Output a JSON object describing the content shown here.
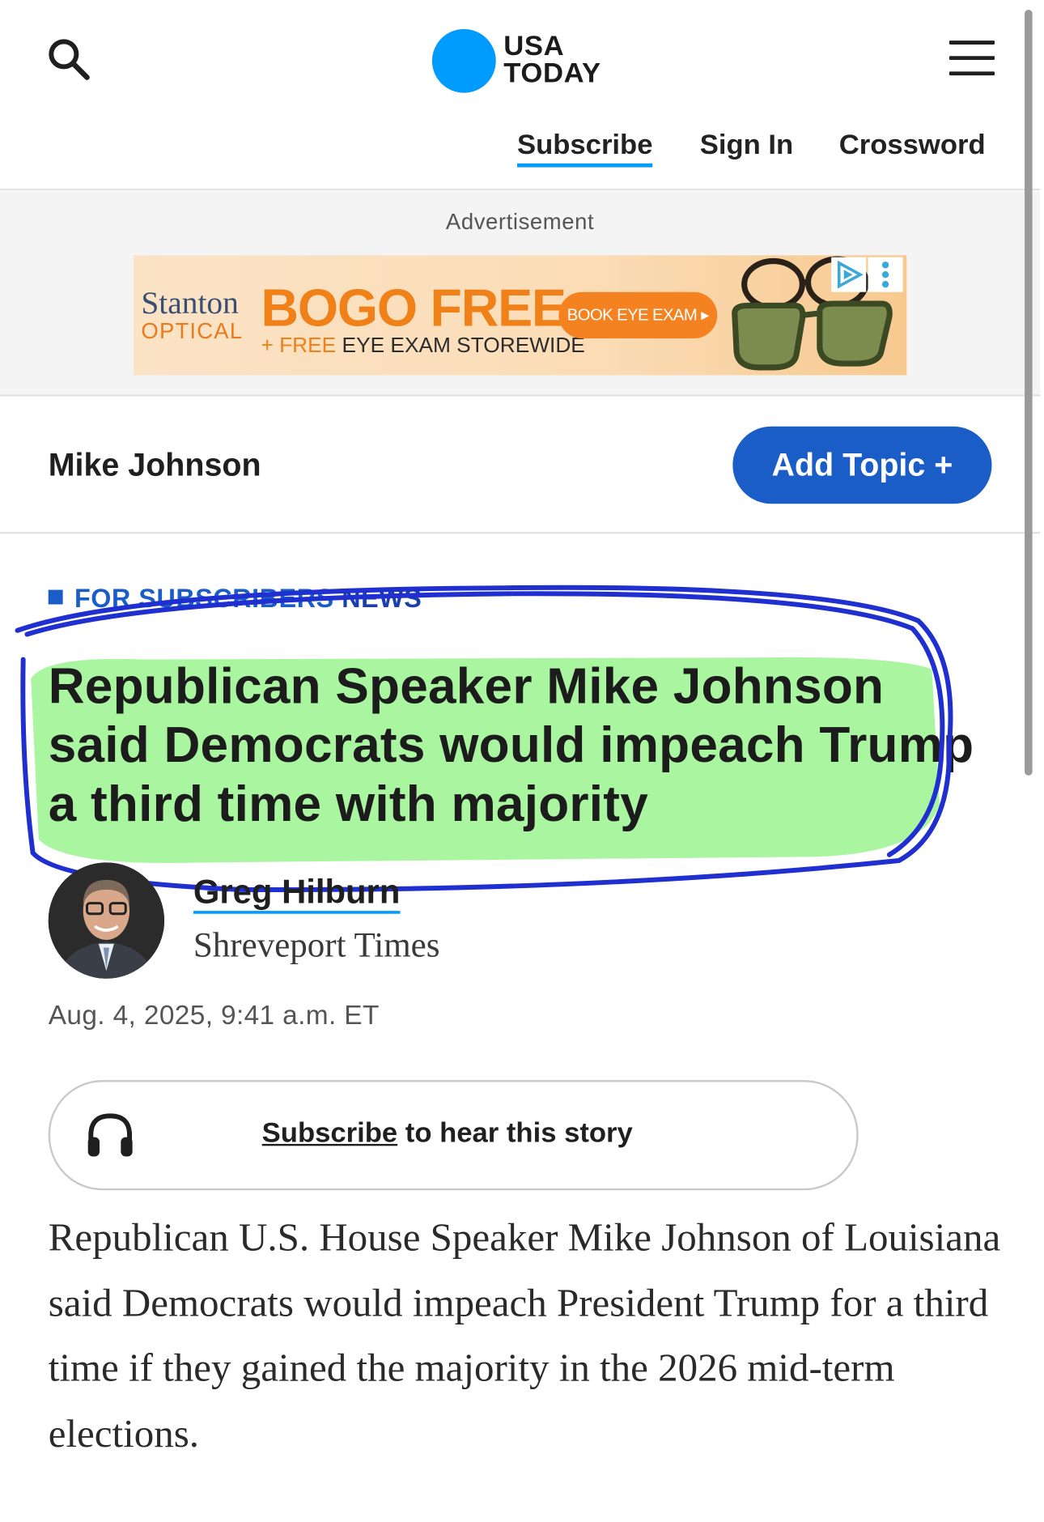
{
  "header": {
    "logo_line1": "USA",
    "logo_line2": "TODAY",
    "nav": {
      "subscribe": "Subscribe",
      "sign_in": "Sign In",
      "crossword": "Crossword"
    }
  },
  "ad": {
    "label": "Advertisement",
    "brand_line1": "Stanton",
    "brand_line2": "OPTICAL",
    "headline": "BOGO FREE",
    "sub_prefix": "+ FREE",
    "sub_rest": "EYE EXAM STOREWIDE",
    "cta": "BOOK EYE EXAM ▸"
  },
  "topic": {
    "name": "Mike Johnson",
    "add_button": "Add Topic +"
  },
  "article": {
    "label_subscribers": "FOR SUBSCRIBERS",
    "label_section": "NEWS",
    "headline": "Republican Speaker Mike Johnson said Democrats would impeach Trump a third time with majority",
    "author": "Greg Hilburn",
    "publication": "Shreveport Times",
    "date": "Aug. 4, 2025, 9:41 a.m. ET",
    "audio_link": "Subscribe",
    "audio_rest": " to hear this story",
    "body": "Republican U.S. House Speaker Mike Johnson of Louisiana said Democrats would impeach President Trump for a third time if they gained the majority in the 2026 mid-term elections."
  },
  "colors": {
    "brand_blue": "#009bff",
    "topic_button": "#1a5dc7",
    "highlight": "#a9f5a0",
    "annotation_circle": "#1f2fd0"
  },
  "icons": [
    "search-icon",
    "menu-icon",
    "ad-choices-icon",
    "more-options-icon",
    "headphones-icon"
  ]
}
